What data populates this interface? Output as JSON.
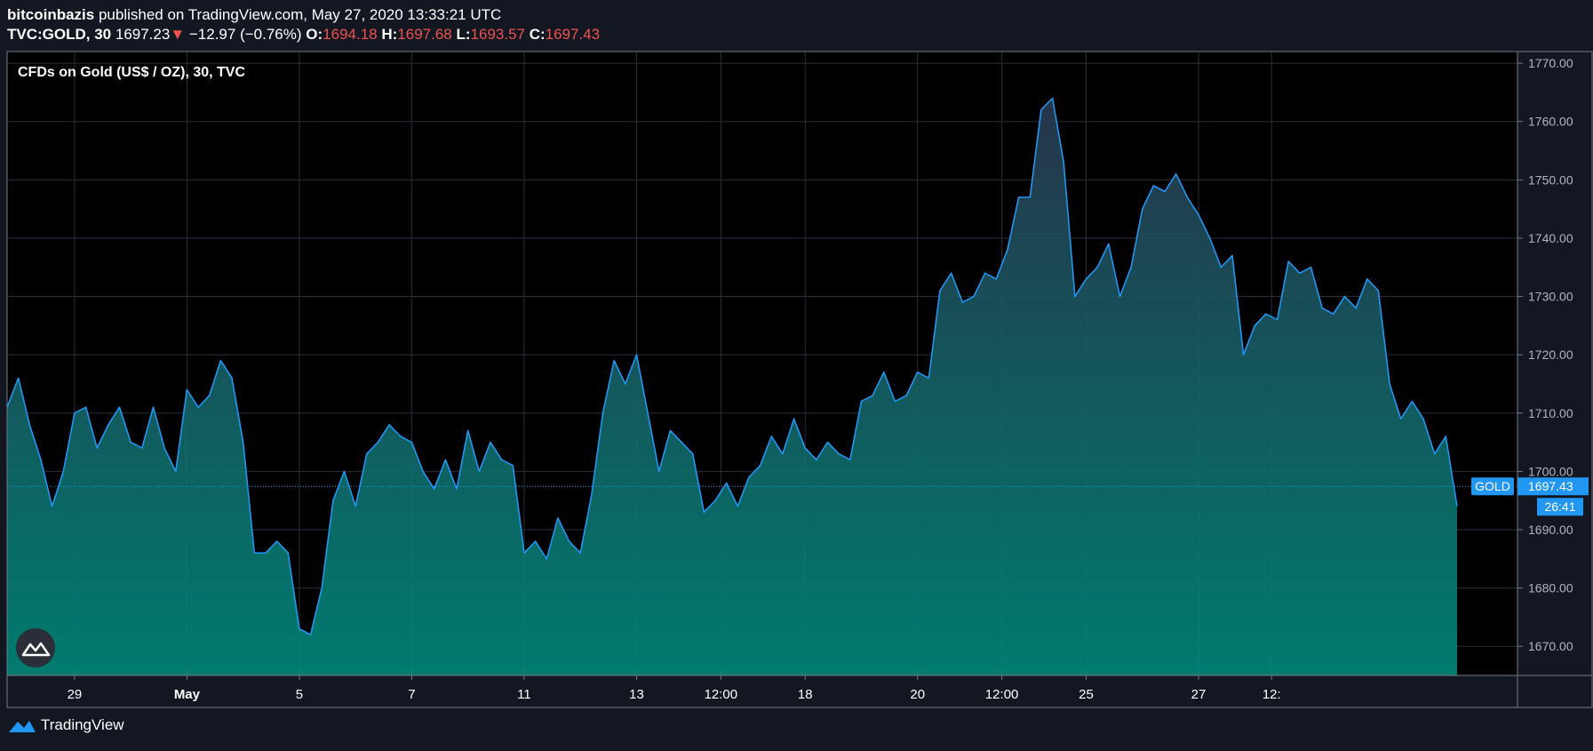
{
  "header": {
    "author": "bitcoinbazis",
    "published_text": "published on TradingView.com, May 27, 2020 13:33:21 UTC",
    "symbol": "TVC:GOLD, 30",
    "last": "1697.23",
    "down_arrow": "▼",
    "change": "−12.97 (−0.76%)",
    "open_label": "O:",
    "open": "1694.18",
    "high_label": "H:",
    "high": "1697.68",
    "low_label": "L:",
    "low": "1693.57",
    "close_label": "C:",
    "close": "1697.43"
  },
  "footer": {
    "brand": "TradingView",
    "icon": "tradingview-logo-icon"
  },
  "colors": {
    "background": "#000000",
    "frame": "#131722",
    "line": "#2196f3",
    "fill_top": "#2a3a52",
    "fill_bottom": "#00897b",
    "price_tag": "#2196f3",
    "grid": "#2a2e39",
    "down": "#ef5350"
  },
  "chart_data": {
    "type": "area",
    "title": "CFDs on Gold (US$ / OZ), 30, TVC",
    "ylim": [
      1665,
      1772
    ],
    "yticks": [
      "1670.00",
      "1680.00",
      "1690.00",
      "1700.00",
      "1710.00",
      "1720.00",
      "1730.00",
      "1740.00",
      "1750.00",
      "1760.00",
      "1770.00"
    ],
    "xticks": [
      {
        "label": "29",
        "idx": 6
      },
      {
        "label": "May",
        "idx": 16,
        "bold": true
      },
      {
        "label": "5",
        "idx": 26
      },
      {
        "label": "7",
        "idx": 36
      },
      {
        "label": "11",
        "idx": 46
      },
      {
        "label": "13",
        "idx": 56
      },
      {
        "label": "12:00",
        "idx": 63.5
      },
      {
        "label": "18",
        "idx": 71
      },
      {
        "label": "20",
        "idx": 81
      },
      {
        "label": "12:00",
        "idx": 88.5
      },
      {
        "label": "25",
        "idx": 96
      },
      {
        "label": "27",
        "idx": 106
      },
      {
        "label": "12:",
        "idx": 112.5
      }
    ],
    "series_name": "GOLD",
    "last_price": "1697.43",
    "countdown": "26:41",
    "values": [
      1711,
      1716,
      1708,
      1702,
      1694,
      1700,
      1710,
      1711,
      1704,
      1708,
      1711,
      1705,
      1704,
      1711,
      1704,
      1700,
      1714,
      1711,
      1713,
      1719,
      1716,
      1705,
      1686,
      1686,
      1688,
      1686,
      1673,
      1672,
      1680,
      1695,
      1700,
      1694,
      1703,
      1705,
      1708,
      1706,
      1705,
      1700,
      1697,
      1702,
      1697,
      1707,
      1700,
      1705,
      1702,
      1701,
      1686,
      1688,
      1685,
      1692,
      1688,
      1686,
      1696,
      1710,
      1719,
      1715,
      1720,
      1710,
      1700,
      1707,
      1705,
      1703,
      1693,
      1695,
      1698,
      1694,
      1699,
      1701,
      1706,
      1703,
      1709,
      1704,
      1702,
      1705,
      1703,
      1702,
      1712,
      1713,
      1717,
      1712,
      1713,
      1717,
      1716,
      1731,
      1734,
      1729,
      1730,
      1734,
      1733,
      1738,
      1747,
      1747,
      1762,
      1764,
      1753,
      1730,
      1733,
      1735,
      1739,
      1730,
      1735,
      1745,
      1749,
      1748,
      1751,
      1747,
      1744,
      1740,
      1735,
      1737,
      1720,
      1725,
      1727,
      1726,
      1736,
      1734,
      1735,
      1728,
      1727,
      1730,
      1728,
      1733,
      1731,
      1715,
      1709,
      1712,
      1709,
      1703,
      1706,
      1694
    ]
  }
}
